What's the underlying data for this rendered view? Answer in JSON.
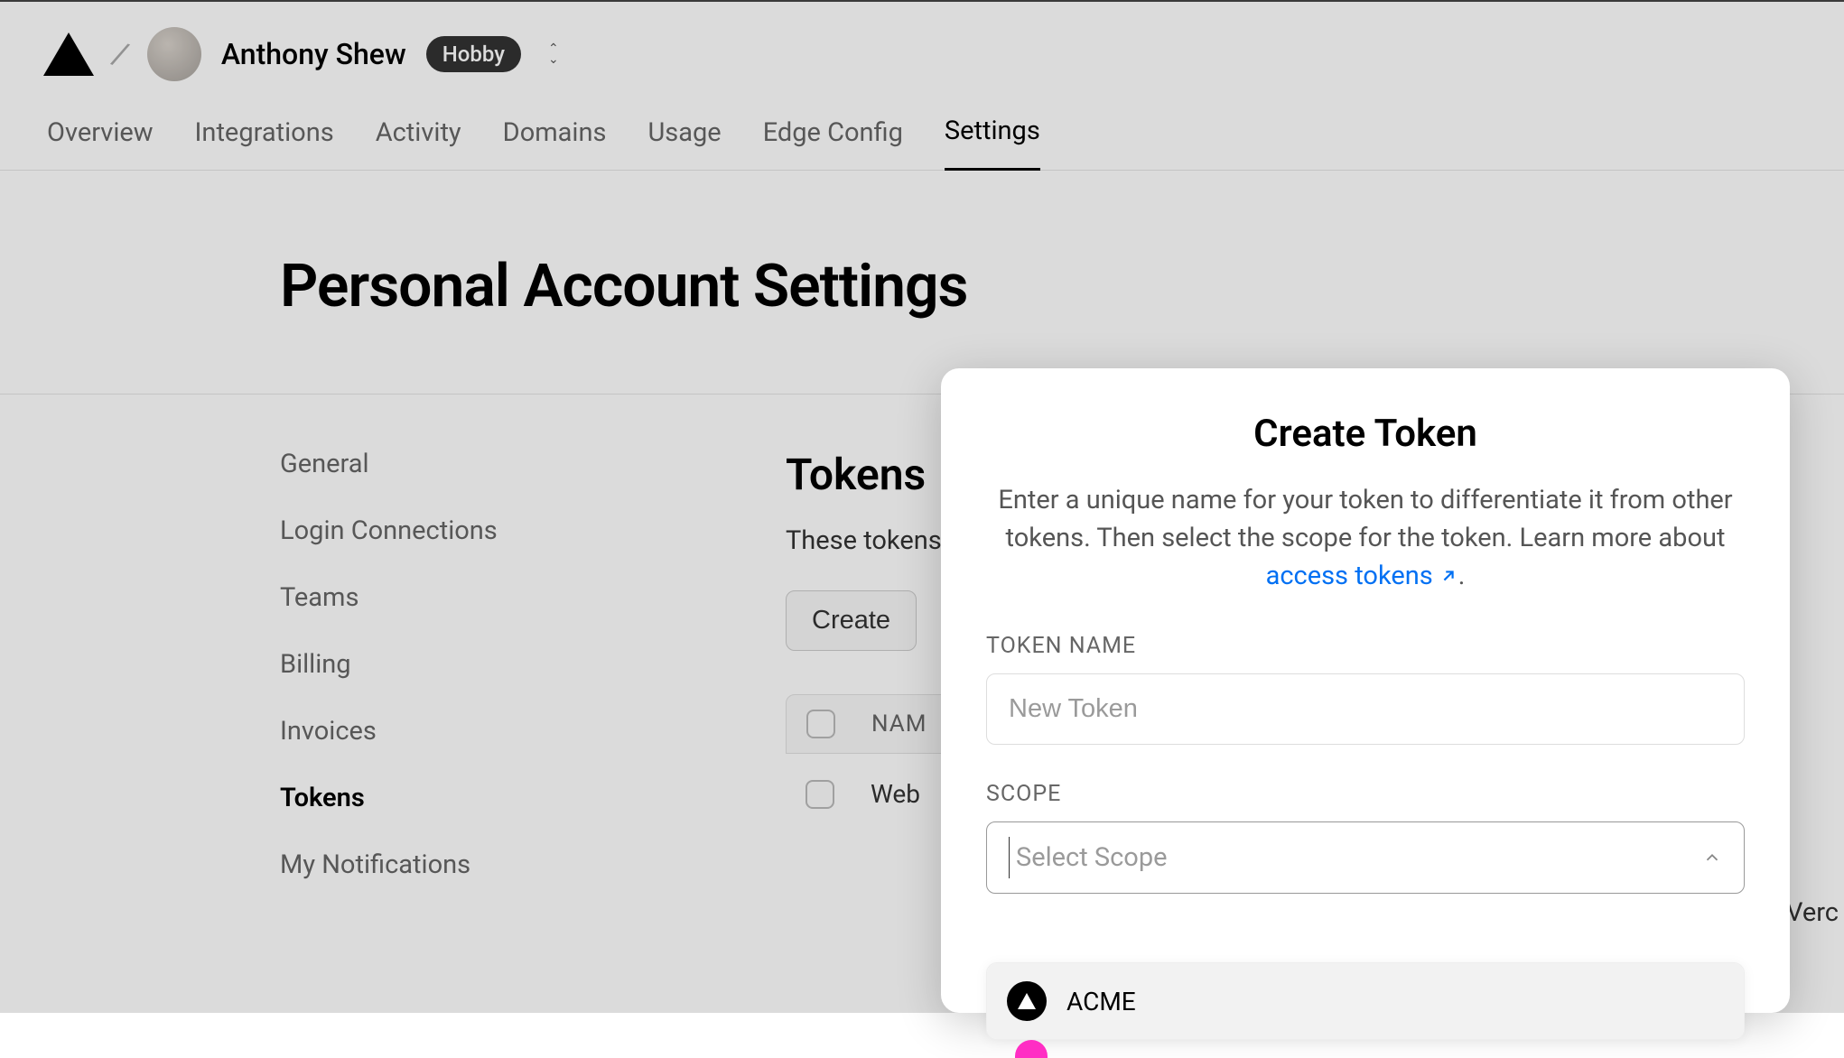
{
  "header": {
    "user_name": "Anthony Shew",
    "plan_badge": "Hobby"
  },
  "nav": {
    "items": [
      "Overview",
      "Integrations",
      "Activity",
      "Domains",
      "Usage",
      "Edge Config",
      "Settings"
    ],
    "active_index": 6
  },
  "page": {
    "title": "Personal Account Settings"
  },
  "sidebar": {
    "items": [
      "General",
      "Login Connections",
      "Teams",
      "Billing",
      "Invoices",
      "Tokens",
      "My Notifications"
    ],
    "active_index": 5
  },
  "main": {
    "section_title": "Tokens",
    "section_desc": "These tokens",
    "create_button": "Create",
    "table_header_col": "NAM",
    "row_1": "Web",
    "bg_right_label": "Verc"
  },
  "modal": {
    "title": "Create Token",
    "description_before_link": "Enter a unique name for your token to differentiate it from other tokens. Then select the scope for the token. Learn more about ",
    "link_text": "access tokens",
    "description_after_link": ".",
    "token_name_label": "TOKEN NAME",
    "token_name_placeholder": "New Token",
    "scope_label": "SCOPE",
    "scope_placeholder": "Select Scope",
    "dropdown_option_1": "ACME"
  }
}
